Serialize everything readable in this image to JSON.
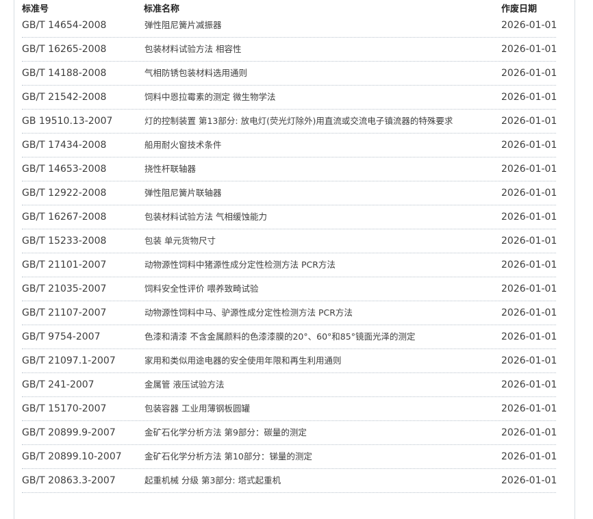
{
  "header": {
    "code_label": "标准号",
    "name_label": "标准名称",
    "date_label": "作废日期"
  },
  "rows": [
    {
      "code": "GB/T 14654-2008",
      "name": "弹性阻尼簧片减振器",
      "date": "2026-01-01"
    },
    {
      "code": "GB/T 16265-2008",
      "name": "包装材料试验方法 相容性",
      "date": "2026-01-01"
    },
    {
      "code": "GB/T 14188-2008",
      "name": "气相防锈包装材料选用通则",
      "date": "2026-01-01"
    },
    {
      "code": "GB/T 21542-2008",
      "name": "饲料中恩拉霉素的测定 微生物学法",
      "date": "2026-01-01"
    },
    {
      "code": "GB 19510.13-2007",
      "name": "灯的控制装置 第13部分: 放电灯(荧光灯除外)用直流或交流电子镇流器的特殊要求",
      "date": "2026-01-01"
    },
    {
      "code": "GB/T 17434-2008",
      "name": "船用耐火窗技术条件",
      "date": "2026-01-01"
    },
    {
      "code": "GB/T 14653-2008",
      "name": "挠性杆联轴器",
      "date": "2026-01-01"
    },
    {
      "code": "GB/T 12922-2008",
      "name": "弹性阻尼簧片联轴器",
      "date": "2026-01-01"
    },
    {
      "code": "GB/T 16267-2008",
      "name": "包装材料试验方法 气相缓蚀能力",
      "date": "2026-01-01"
    },
    {
      "code": "GB/T 15233-2008",
      "name": "包装 单元货物尺寸",
      "date": "2026-01-01"
    },
    {
      "code": "GB/T 21101-2007",
      "name": "动物源性饲料中猪源性成分定性检测方法 PCR方法",
      "date": "2026-01-01"
    },
    {
      "code": "GB/T 21035-2007",
      "name": "饲料安全性评价 喂养致畸试验",
      "date": "2026-01-01"
    },
    {
      "code": "GB/T 21107-2007",
      "name": "动物源性饲料中马、驴源性成分定性检测方法 PCR方法",
      "date": "2026-01-01"
    },
    {
      "code": "GB/T 9754-2007",
      "name": "色漆和清漆 不含金属颜料的色漆漆膜的20°、60°和85°镜面光泽的测定",
      "date": "2026-01-01"
    },
    {
      "code": "GB/T 21097.1-2007",
      "name": "家用和类似用途电器的安全使用年限和再生利用通则",
      "date": "2026-01-01"
    },
    {
      "code": "GB/T 241-2007",
      "name": "金属管 液压试验方法",
      "date": "2026-01-01"
    },
    {
      "code": "GB/T 15170-2007",
      "name": "包装容器 工业用薄钢板圆罐",
      "date": "2026-01-01"
    },
    {
      "code": "GB/T 20899.9-2007",
      "name": "金矿石化学分析方法 第9部分：碳量的测定",
      "date": "2026-01-01"
    },
    {
      "code": "GB/T 20899.10-2007",
      "name": "金矿石化学分析方法 第10部分：锑量的测定",
      "date": "2026-01-01"
    },
    {
      "code": "GB/T 20863.3-2007",
      "name": "起重机械 分级 第3部分: 塔式起重机",
      "date": "2026-01-01"
    }
  ]
}
